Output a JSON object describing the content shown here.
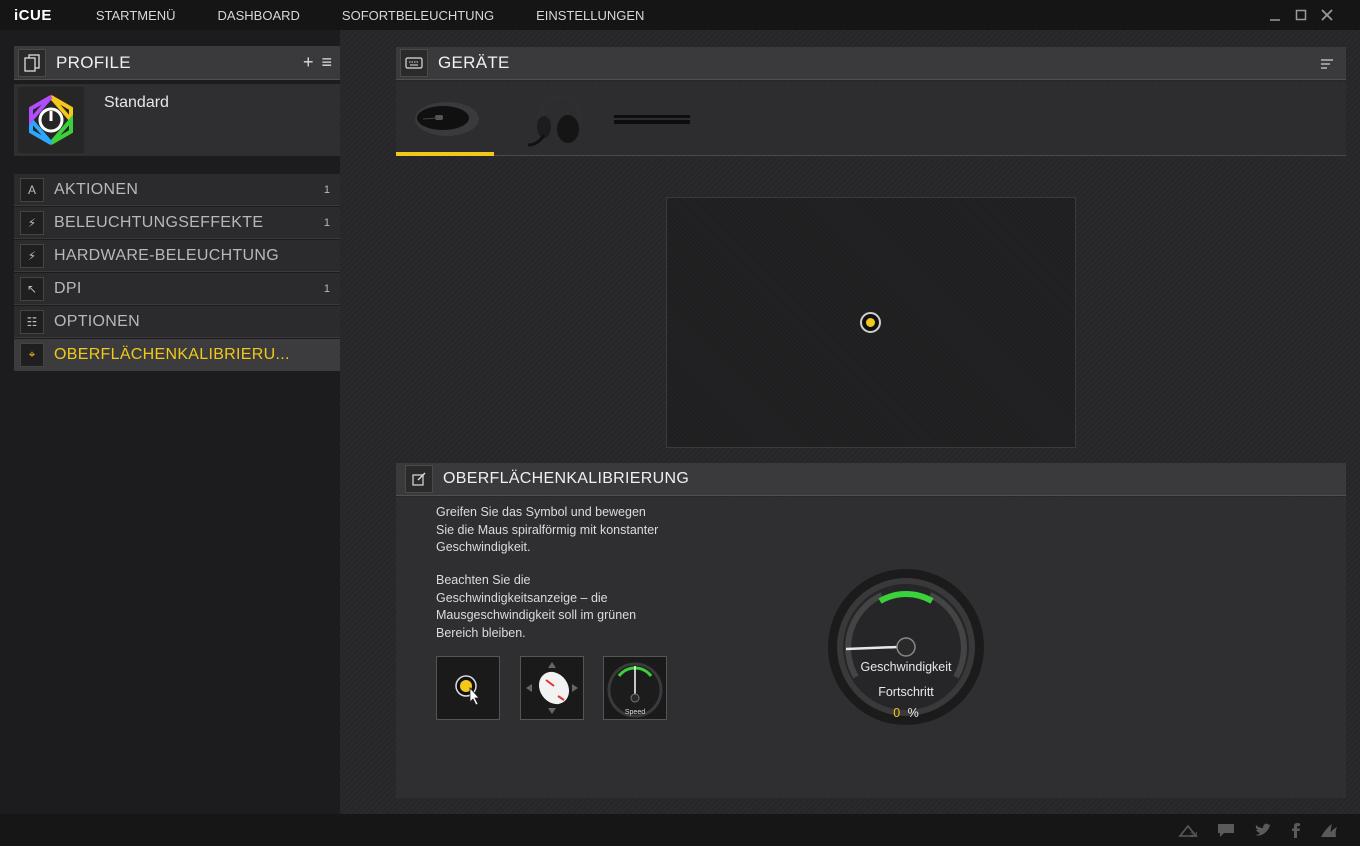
{
  "app": {
    "title": "iCUE",
    "nav": [
      "STARTMENÜ",
      "DASHBOARD",
      "SOFORTBELEUCHTUNG",
      "EINSTELLUNGEN"
    ]
  },
  "window_controls": {
    "minimize_icon": "minimize-icon",
    "maximize_icon": "maximize-icon",
    "close_icon": "close-icon"
  },
  "profile_panel": {
    "title": "PROFILE",
    "add_symbol": "+",
    "menu_symbol": "≡",
    "profile_name": "Standard"
  },
  "menu": [
    {
      "icon_char": "A",
      "label": "AKTIONEN",
      "count": "1",
      "active": false
    },
    {
      "icon_char": "⚡",
      "label": "BELEUCHTUNGSEFFEKTE",
      "count": "1",
      "active": false
    },
    {
      "icon_char": "⚡",
      "label": "HARDWARE-BELEUCHTUNG",
      "count": "",
      "active": false
    },
    {
      "icon_char": "↖",
      "label": "DPI",
      "count": "1",
      "active": false
    },
    {
      "icon_char": "☷",
      "label": "OPTIONEN",
      "count": "",
      "active": false
    },
    {
      "icon_char": "⌖",
      "label": "OBERFLÄCHENKALIBRIERU...",
      "count": "",
      "active": true
    }
  ],
  "devices": {
    "title": "GERÄTE",
    "tabs": [
      "mouse",
      "headset",
      "mousepad"
    ],
    "active_tab": 0
  },
  "calibration": {
    "title": "OBERFLÄCHENKALIBRIERUNG",
    "instruction_1": "Greifen Sie das Symbol und bewegen Sie die Maus spiralförmig mit konstanter Geschwindigkeit.",
    "instruction_2": "Beachten Sie die Geschwindigkeitsanzeige – die Mausgeschwindigkeit soll im grünen Bereich bleiben.",
    "thumb_speed_label": "Speed",
    "gauge_speed_label": "Geschwindigkeit",
    "progress_label": "Fortschritt",
    "progress_value": "0",
    "progress_unit": "%"
  },
  "colors": {
    "accent": "#f2c91a",
    "green": "#3ad13a"
  }
}
